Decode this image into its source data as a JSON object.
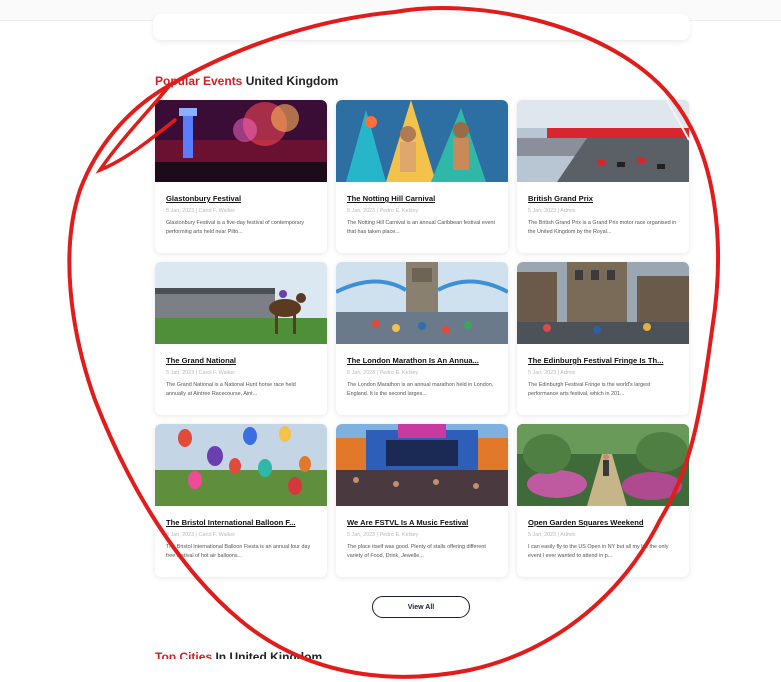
{
  "section": {
    "title_accent": "Popular Events",
    "title_rest": " United Kingdom"
  },
  "events": [
    {
      "title": "Glastonbury Festival",
      "meta": "5 Jan, 2023 | Carol F. Walker",
      "desc": "Glastonbury Festival is a five-day festival of contemporary performing arts held near Pilto..."
    },
    {
      "title": "The Notting Hill Carnival",
      "meta": "5 Jan, 2023 | Pedro E. Kelsey",
      "desc": "The Notting Hill Carnival is an annual Caribbean festival event that has taken place..."
    },
    {
      "title": "British Grand Prix",
      "meta": "5 Jan, 2023 | Admin",
      "desc": "The British Grand Prix is a Grand Prix motor race organised in the United Kingdom by the Royal..."
    },
    {
      "title": "The Grand National",
      "meta": "5 Jan, 2023 | Carol F. Walker",
      "desc": "The Grand National is a National Hunt horse race held annually at Aintree Racecourse, Aint..."
    },
    {
      "title": "The London Marathon Is An Annua...",
      "meta": "5 Jan, 2023 | Pedro E. Kelsey",
      "desc": "The London Marathon is an annual marathon held in London, England. It is the second larges..."
    },
    {
      "title": "The Edinburgh Festival Fringe Is Th...",
      "meta": "5 Jan, 2023 | Admin",
      "desc": "The Edinburgh Festival Fringe is the world's largest performance arts festival, which in 201..."
    },
    {
      "title": "The Bristol International Balloon F...",
      "meta": "5 Jan, 2023 | Carol F. Walker",
      "desc": "The Bristol International Balloon Fiesta is an annual four day free festival of hot air balloons..."
    },
    {
      "title": "We Are FSTVL Is A Music Festival",
      "meta": "5 Jan, 2023 | Pedro E. Kelsey",
      "desc": "The place itself was good. Plenty of stalls offering different variety of Food, Drink, Jewelle..."
    },
    {
      "title": "Open Garden Squares Weekend",
      "meta": "5 Jan, 2023 | Admin",
      "desc": "I can easily fly to the US Open in NY but all my life the only event I ever wanted to attend in p..."
    }
  ],
  "view_all_label": "View All",
  "next_section": {
    "title_accent": "Top Cities",
    "title_rest": " In United Kingdom"
  },
  "colors": {
    "accent": "#d71d23",
    "annotation": "#e21b1b",
    "button_border": "#1b1b3a"
  }
}
